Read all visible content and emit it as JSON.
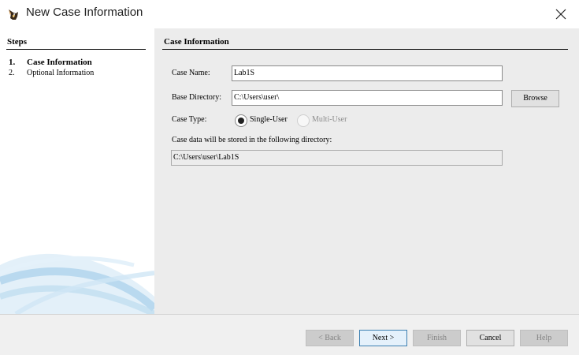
{
  "window": {
    "title": "New Case Information"
  },
  "steps": {
    "header": "Steps",
    "items": [
      {
        "num": "1.",
        "label": "Case Information"
      },
      {
        "num": "2.",
        "label": "Optional Information"
      }
    ]
  },
  "content": {
    "header": "Case Information",
    "case_name": {
      "label": "Case Name:",
      "value": "Lab1S"
    },
    "base_directory": {
      "label": "Base Directory:",
      "value": "C:\\Users\\user\\",
      "browse_label": "Browse"
    },
    "case_type": {
      "label": "Case Type:",
      "single_user": "Single-User",
      "multi_user": "Multi-User",
      "selected": "Single-User"
    },
    "storage_note": "Case data will be stored in the following directory:",
    "storage_path": "C:\\Users\\user\\Lab1S"
  },
  "buttons": {
    "back": "< Back",
    "next": "Next >",
    "finish": "Finish",
    "cancel": "Cancel",
    "help": "Help"
  },
  "icons": {
    "app": "autopsy-dog-icon",
    "close": "close-icon"
  },
  "colors": {
    "content_bg": "#ececec",
    "bottom_bar_bg": "#f0f0f0",
    "swoosh": "#7fb8e0"
  }
}
